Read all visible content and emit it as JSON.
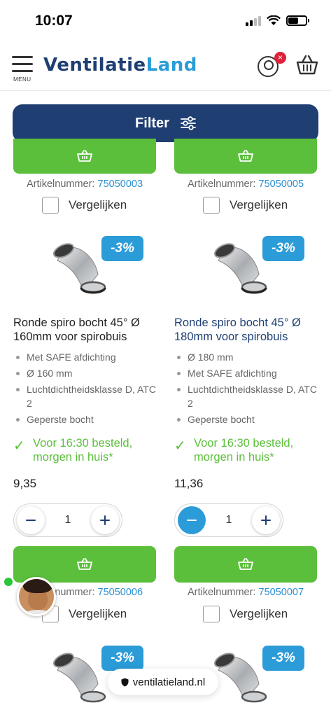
{
  "status_bar": {
    "time": "10:07"
  },
  "header": {
    "menu_label": "MENU",
    "logo_part1": "Ventilatie",
    "logo_part2": "Land",
    "account_badge": "×"
  },
  "filter": {
    "label": "Filter"
  },
  "top_row": {
    "left": {
      "sku_label": "Artikelnummer:",
      "sku": "75050003",
      "compare_label": "Vergelijken"
    },
    "right": {
      "sku_label": "Artikelnummer:",
      "sku": "75050005",
      "compare_label": "Vergelijken"
    }
  },
  "products": [
    {
      "discount": "-3%",
      "title": "Ronde spiro bocht 45° Ø 160mm voor spirobuis",
      "features": [
        "Met SAFE afdichting",
        "Ø 160 mm",
        "Luchtdichtheidsklasse D, ATC 2",
        "Geperste bocht"
      ],
      "delivery": "Voor 16:30 besteld, morgen in huis*",
      "price": "9,35",
      "quantity": "1",
      "sku_label": "Artikelnummer:",
      "sku": "75050006",
      "compare_label": "Vergelijken"
    },
    {
      "discount": "-3%",
      "title": "Ronde spiro bocht 45° Ø 180mm voor spirobuis",
      "features": [
        "Ø 180 mm",
        "Met SAFE afdichting",
        "Luchtdichtheidsklasse D, ATC 2",
        "Geperste bocht"
      ],
      "delivery": "Voor 16:30 besteld, morgen in huis*",
      "price": "11,36",
      "quantity": "1",
      "sku_label": "Artikelnummer:",
      "sku": "75050007",
      "compare_label": "Vergelijken"
    }
  ],
  "next_row": {
    "left_discount": "-3%",
    "right_discount": "-3%"
  },
  "url_bar": {
    "domain": "ventilatieland.nl"
  },
  "colors": {
    "brand_navy": "#1f3f73",
    "brand_blue": "#2b9cd8",
    "cart_green": "#5bbf3b",
    "badge_red": "#e0213a"
  }
}
